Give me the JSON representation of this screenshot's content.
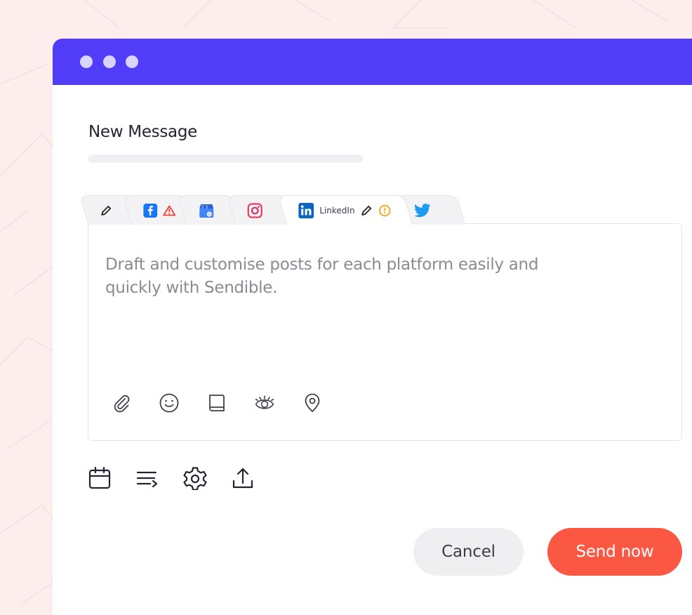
{
  "window": {
    "controls": [
      "close",
      "minimize",
      "maximize"
    ]
  },
  "composer": {
    "title": "New Message",
    "placeholder_text": "Draft and customise posts for each platform easily and quickly with Sendible."
  },
  "tabs": [
    {
      "name": "edit-all",
      "icon": "pencil-icon"
    },
    {
      "name": "facebook",
      "icon": "facebook-icon",
      "status": "warning"
    },
    {
      "name": "google-business",
      "icon": "google-my-business-icon"
    },
    {
      "name": "instagram",
      "icon": "instagram-icon"
    },
    {
      "name": "linkedin",
      "icon": "linkedin-icon",
      "label": "LinkedIn",
      "status": "info",
      "active": true
    },
    {
      "name": "twitter",
      "icon": "twitter-icon"
    }
  ],
  "editor_tools": [
    "attachment-icon",
    "emoji-icon",
    "library-icon",
    "preview-icon",
    "location-icon"
  ],
  "bottom_tools": [
    "calendar-icon",
    "queue-icon",
    "settings-icon",
    "upload-icon"
  ],
  "actions": {
    "cancel_label": "Cancel",
    "send_label": "Send now"
  },
  "colors": {
    "titlebar": "#513cf7",
    "send_button": "#fb5844",
    "background": "#fdeeed",
    "warning": "#e8412c",
    "info": "#f3a712",
    "facebook": "#1877f2",
    "linkedin": "#0a66c2",
    "twitter": "#1d9bf0"
  }
}
